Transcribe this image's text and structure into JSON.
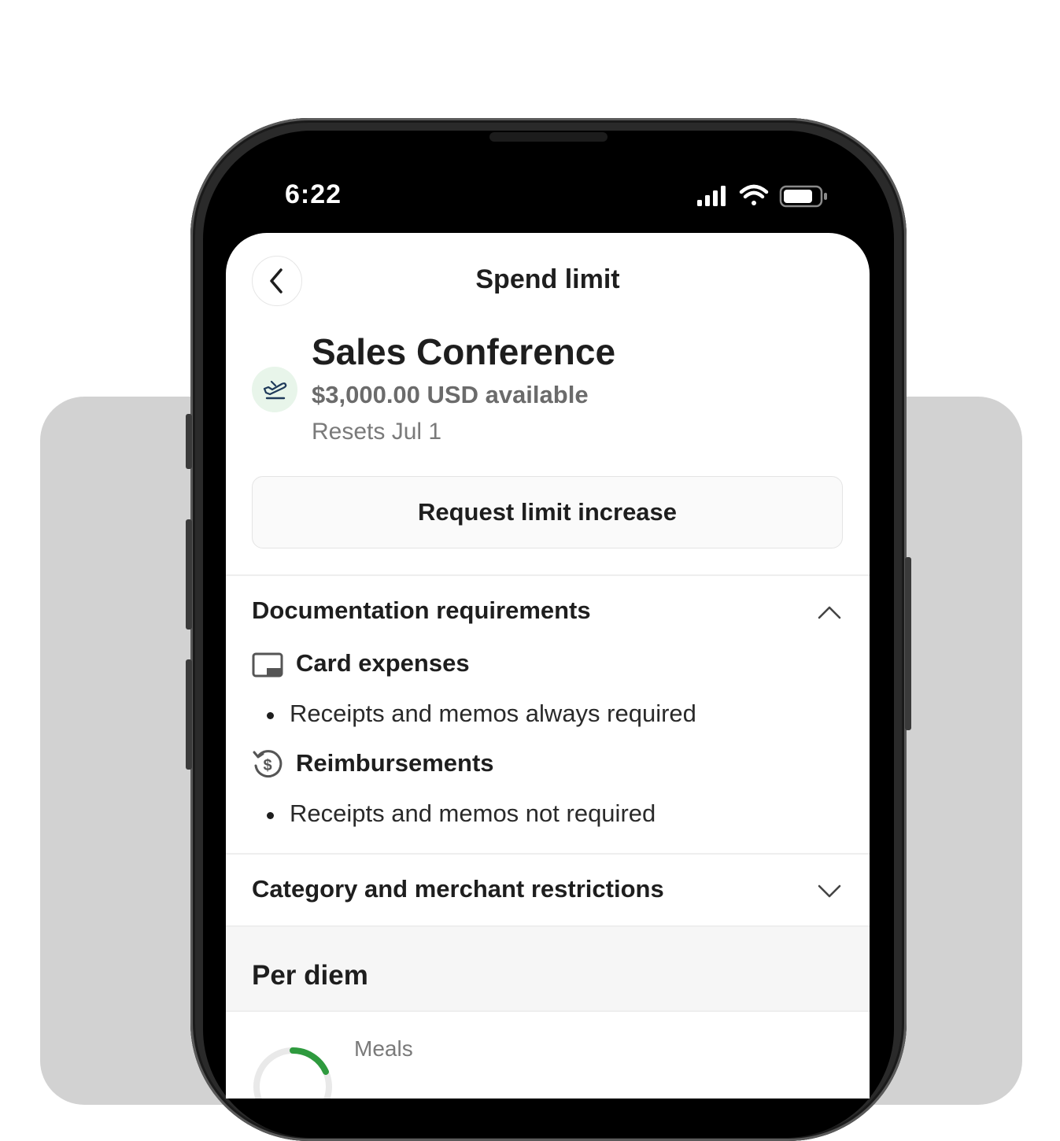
{
  "status_bar": {
    "time": "6:22"
  },
  "header": {
    "title": "Spend limit"
  },
  "limit": {
    "name": "Sales Conference",
    "available": "$3,000.00 USD available",
    "reset": "Resets Jul 1"
  },
  "actions": {
    "request_increase": "Request limit increase"
  },
  "documentation": {
    "title": "Documentation requirements",
    "expanded": true,
    "card_expenses": {
      "title": "Card expenses",
      "rule": "Receipts and memos always required"
    },
    "reimbursements": {
      "title": "Reimbursements",
      "rule": "Receipts and memos not required"
    }
  },
  "restrictions": {
    "title": "Category and merchant restrictions",
    "expanded": false
  },
  "per_diem": {
    "title": "Per diem",
    "meals_label": "Meals"
  },
  "colors": {
    "accent_green": "#2e9a3e",
    "icon_bg_green": "#e8f5ea",
    "text_primary": "#1e1e1e",
    "text_secondary": "#6b6b6b"
  },
  "icons": {
    "back": "chevron-left-icon",
    "limit": "airplane-icon",
    "card": "card-icon",
    "reimburse": "dollar-refresh-icon",
    "collapse": "chevron-up-icon",
    "expand": "chevron-down-icon"
  }
}
